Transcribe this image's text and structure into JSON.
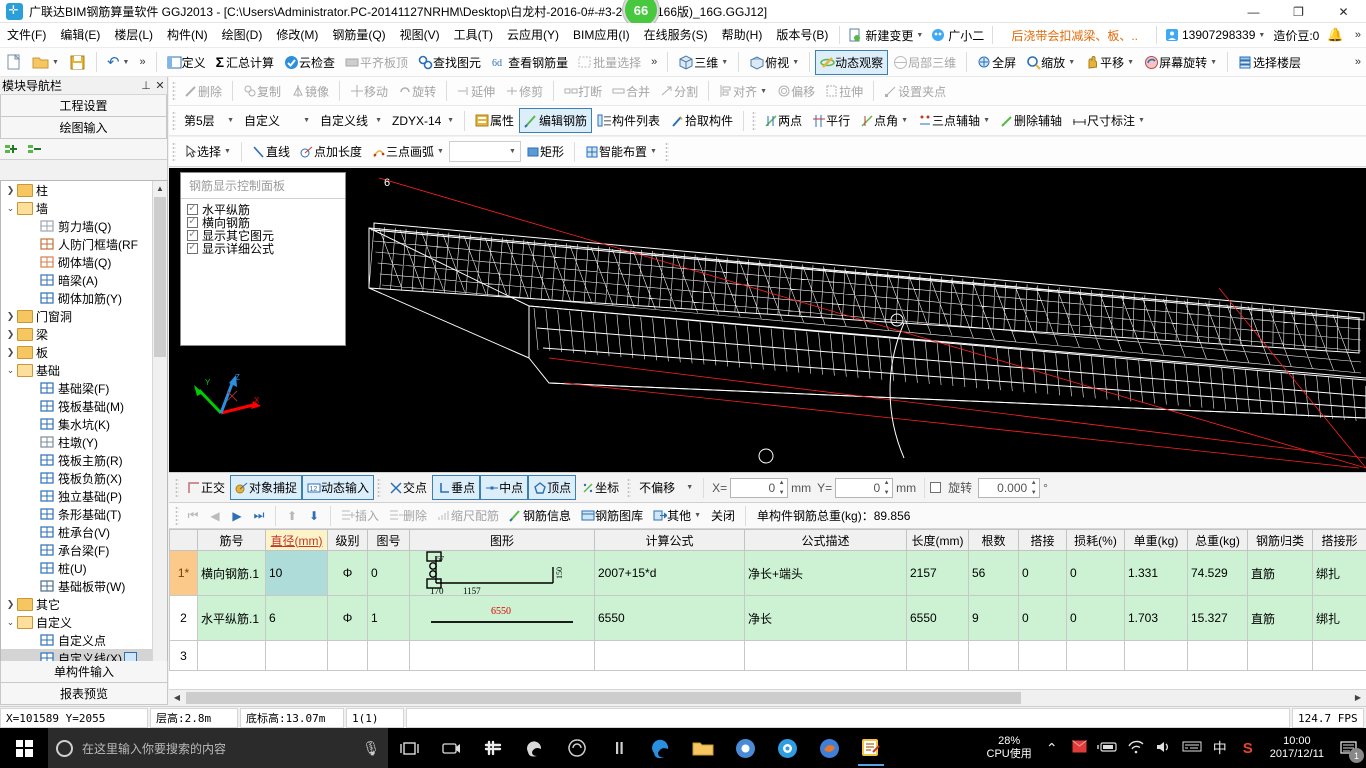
{
  "window": {
    "title": "广联达BIM钢筋算量软件 GGJ2013 - [C:\\Users\\Administrator.PC-20141127NRHM\\Desktop\\白龙村-2016-0#-#3-27-07(2166版)_16G.GGJ12]",
    "badge": "66",
    "minimize": "—",
    "maximize": "❐",
    "close": "✕",
    "app_icon": "bim-app-icon"
  },
  "menubar": {
    "items": [
      "文件(F)",
      "编辑(E)",
      "楼层(L)",
      "构件(N)",
      "绘图(D)",
      "修改(M)",
      "钢筋量(Q)",
      "视图(V)",
      "工具(T)",
      "云应用(Y)",
      "BIM应用(I)",
      "在线服务(S)",
      "帮助(H)",
      "版本号(B)"
    ],
    "new_change": "新建变更",
    "user_nick": "广小二",
    "promo": "后浇带会扣减梁、板、..",
    "phone": "13907298339",
    "coin_label": "造价豆:0",
    "overflow": "»"
  },
  "toolbar1": {
    "left_icons": [
      "new-file-icon",
      "open-folder-icon",
      "save-icon",
      "undo-icon"
    ],
    "overflow": "»",
    "buttons": [
      {
        "label": "定义",
        "icon": "define-icon",
        "enabled": true
      },
      {
        "label": "汇总计算",
        "icon": "sigma-icon",
        "enabled": true
      },
      {
        "label": "云检查",
        "icon": "cloud-check-icon",
        "enabled": true
      },
      {
        "label": "平齐板顶",
        "icon": "align-slab-icon",
        "enabled": false
      },
      {
        "label": "查找图元",
        "icon": "find-element-icon",
        "enabled": true
      },
      {
        "label": "查看钢筋量",
        "icon": "view-rebar-icon",
        "enabled": true
      },
      {
        "label": "批量选择",
        "icon": "batch-select-icon",
        "enabled": false
      }
    ],
    "view_buttons": [
      {
        "label": "三维",
        "icon": "cube-3d-icon",
        "enabled": true,
        "dropdown": true
      },
      {
        "label": "俯视",
        "icon": "topview-icon",
        "enabled": true,
        "dropdown": true
      },
      {
        "label": "动态观察",
        "icon": "orbit-icon",
        "enabled": true,
        "selected": true
      },
      {
        "label": "局部三维",
        "icon": "partial-3d-icon",
        "enabled": false
      },
      {
        "label": "全屏",
        "icon": "fullscreen-icon",
        "enabled": true
      },
      {
        "label": "缩放",
        "icon": "zoom-icon",
        "enabled": true,
        "dropdown": true
      },
      {
        "label": "平移",
        "icon": "pan-hand-icon",
        "enabled": true,
        "dropdown": true
      },
      {
        "label": "屏幕旋转",
        "icon": "screen-rotate-icon",
        "enabled": true,
        "dropdown": true
      },
      {
        "label": "选择楼层",
        "icon": "select-floor-icon",
        "enabled": true
      }
    ]
  },
  "toolbar2": {
    "buttons": [
      {
        "label": "删除",
        "icon": "delete-icon"
      },
      {
        "label": "复制",
        "icon": "copy-icon"
      },
      {
        "label": "镜像",
        "icon": "mirror-icon"
      },
      {
        "label": "移动",
        "icon": "move-icon"
      },
      {
        "label": "旋转",
        "icon": "rotate-icon"
      },
      {
        "label": "延伸",
        "icon": "extend-icon"
      },
      {
        "label": "修剪",
        "icon": "trim-icon"
      },
      {
        "label": "打断",
        "icon": "break-icon"
      },
      {
        "label": "合并",
        "icon": "merge-icon"
      },
      {
        "label": "分割",
        "icon": "split-icon"
      },
      {
        "label": "对齐",
        "icon": "align-icon",
        "dropdown": true
      },
      {
        "label": "偏移",
        "icon": "offset-icon"
      },
      {
        "label": "拉伸",
        "icon": "stretch-icon"
      },
      {
        "label": "设置夹点",
        "icon": "set-grip-icon"
      }
    ]
  },
  "toolbar3": {
    "floor": "第5层",
    "type1": "自定义",
    "type2": "自定义线",
    "component": "ZDYX-14",
    "buttons": [
      {
        "label": "属性",
        "icon": "properties-icon",
        "selected": false
      },
      {
        "label": "编辑钢筋",
        "icon": "edit-rebar-icon",
        "selected": true
      },
      {
        "label": "构件列表",
        "icon": "component-list-icon",
        "selected": false
      },
      {
        "label": "拾取构件",
        "icon": "pick-component-icon",
        "selected": false
      }
    ],
    "axis_buttons": [
      {
        "label": "两点",
        "icon": "two-point-icon"
      },
      {
        "label": "平行",
        "icon": "parallel-icon"
      },
      {
        "label": "点角",
        "icon": "point-angle-icon",
        "dropdown": true
      },
      {
        "label": "三点辅轴",
        "icon": "three-point-axis-icon",
        "dropdown": true
      },
      {
        "label": "删除辅轴",
        "icon": "delete-axis-icon"
      },
      {
        "label": "尺寸标注",
        "icon": "dimension-icon",
        "dropdown": true
      }
    ]
  },
  "toolbar4": {
    "buttons": [
      {
        "label": "选择",
        "icon": "cursor-select-icon",
        "dropdown": true
      },
      {
        "label": "直线",
        "icon": "line-icon"
      },
      {
        "label": "点加长度",
        "icon": "point-length-icon"
      },
      {
        "label": "三点画弧",
        "icon": "three-point-arc-icon",
        "dropdown": true
      }
    ],
    "combo_value": "",
    "buttons2": [
      {
        "label": "矩形",
        "icon": "rectangle-icon"
      },
      {
        "label": "智能布置",
        "icon": "smart-layout-icon",
        "dropdown": true
      }
    ]
  },
  "sidebar": {
    "title": "模块导航栏",
    "pin": "⊥",
    "close": "✕",
    "nav_buttons_top": [
      "工程设置",
      "绘图输入"
    ],
    "nav_buttons_bottom": [
      "单构件输入",
      "报表预览"
    ],
    "tree": [
      {
        "label": "柱",
        "depth": 1,
        "twisty": "collapsed",
        "icon": "folder-icon"
      },
      {
        "label": "墙",
        "depth": 1,
        "twisty": "expanded",
        "icon": "folder-open-icon"
      },
      {
        "label": "剪力墙(Q)",
        "depth": 2,
        "icon": "shear-wall-icon"
      },
      {
        "label": "人防门框墙(RF",
        "depth": 2,
        "icon": "door-frame-wall-icon"
      },
      {
        "label": "砌体墙(Q)",
        "depth": 2,
        "icon": "masonry-wall-icon"
      },
      {
        "label": "暗梁(A)",
        "depth": 2,
        "icon": "hidden-beam-icon"
      },
      {
        "label": "砌体加筋(Y)",
        "depth": 2,
        "icon": "masonry-rebar-icon"
      },
      {
        "label": "门窗洞",
        "depth": 1,
        "twisty": "collapsed",
        "icon": "folder-icon"
      },
      {
        "label": "梁",
        "depth": 1,
        "twisty": "collapsed",
        "icon": "folder-icon"
      },
      {
        "label": "板",
        "depth": 1,
        "twisty": "collapsed",
        "icon": "folder-icon"
      },
      {
        "label": "基础",
        "depth": 1,
        "twisty": "expanded",
        "icon": "folder-open-icon"
      },
      {
        "label": "基础梁(F)",
        "depth": 2,
        "icon": "foundation-beam-icon"
      },
      {
        "label": "筏板基础(M)",
        "depth": 2,
        "icon": "raft-foundation-icon"
      },
      {
        "label": "集水坑(K)",
        "depth": 2,
        "icon": "sump-pit-icon"
      },
      {
        "label": "柱墩(Y)",
        "depth": 2,
        "icon": "column-pier-icon"
      },
      {
        "label": "筏板主筋(R)",
        "depth": 2,
        "icon": "raft-main-rebar-icon"
      },
      {
        "label": "筏板负筋(X)",
        "depth": 2,
        "icon": "raft-neg-rebar-icon"
      },
      {
        "label": "独立基础(P)",
        "depth": 2,
        "icon": "isolated-foundation-icon"
      },
      {
        "label": "条形基础(T)",
        "depth": 2,
        "icon": "strip-foundation-icon"
      },
      {
        "label": "桩承台(V)",
        "depth": 2,
        "icon": "pile-cap-icon"
      },
      {
        "label": "承台梁(F)",
        "depth": 2,
        "icon": "cap-beam-icon"
      },
      {
        "label": "桩(U)",
        "depth": 2,
        "icon": "pile-icon"
      },
      {
        "label": "基础板带(W)",
        "depth": 2,
        "icon": "foundation-band-icon"
      },
      {
        "label": "其它",
        "depth": 1,
        "twisty": "collapsed",
        "icon": "folder-icon"
      },
      {
        "label": "自定义",
        "depth": 1,
        "twisty": "expanded",
        "icon": "folder-open-icon"
      },
      {
        "label": "自定义点",
        "depth": 2,
        "icon": "custom-point-icon"
      },
      {
        "label": "自定义线(X)",
        "depth": 2,
        "icon": "custom-line-icon",
        "selected": true
      },
      {
        "label": "自定义面",
        "depth": 2,
        "icon": "custom-face-icon"
      },
      {
        "label": "尺寸标注(W)",
        "depth": 2,
        "icon": "dimension-icon"
      }
    ]
  },
  "viewport": {
    "panel": {
      "title": "钢筋显示控制面板",
      "checkboxes": [
        {
          "label": "水平纵筋",
          "checked": true
        },
        {
          "label": "横向钢筋",
          "checked": true
        },
        {
          "label": "显示其它图元",
          "checked": true
        },
        {
          "label": "显示详细公式",
          "checked": true
        }
      ]
    },
    "axis_labels": [
      "X",
      "Y",
      "Z"
    ],
    "axis_colors": {
      "x": "#ff0000",
      "y": "#00cc00",
      "z": "#2b8fe0"
    }
  },
  "drawbar": {
    "toggles": [
      {
        "label": "正交",
        "icon": "ortho-icon",
        "active": false
      },
      {
        "label": "对象捕捉",
        "icon": "object-snap-icon",
        "active": true
      },
      {
        "label": "动态输入",
        "icon": "dynamic-input-icon",
        "active": true
      }
    ],
    "snaps": [
      {
        "label": "交点",
        "icon": "intersection-icon",
        "active": false
      },
      {
        "label": "垂点",
        "icon": "perpendicular-icon",
        "active": true
      },
      {
        "label": "中点",
        "icon": "midpoint-icon",
        "active": true
      },
      {
        "label": "顶点",
        "icon": "vertex-icon",
        "active": true
      },
      {
        "label": "坐标",
        "icon": "coordinate-icon",
        "active": false
      }
    ],
    "offset_mode": "不偏移",
    "x_label": "X=",
    "x_value": "0",
    "x_unit": "mm",
    "y_label": "Y=",
    "y_value": "0",
    "y_unit": "mm",
    "rotate_label": "旋转",
    "rotate_value": "0.000",
    "rotate_unit": "°"
  },
  "rebarbar": {
    "nav": [
      "⏮",
      "◀",
      "▶",
      "⏭",
      "⬆",
      "⬇"
    ],
    "buttons": [
      {
        "label": "插入",
        "icon": "insert-row-icon",
        "enabled": false
      },
      {
        "label": "删除",
        "icon": "delete-row-icon",
        "enabled": false
      },
      {
        "label": "缩尺配筋",
        "icon": "scale-rebar-icon",
        "enabled": false
      },
      {
        "label": "钢筋信息",
        "icon": "rebar-info-icon",
        "enabled": true
      },
      {
        "label": "钢筋图库",
        "icon": "rebar-library-icon",
        "enabled": true
      },
      {
        "label": "其他",
        "icon": "other-icon",
        "enabled": true,
        "dropdown": true
      },
      {
        "label": "关闭",
        "icon": "close-panel-icon",
        "enabled": true
      }
    ],
    "total_label": "单构件钢筋总重(kg)：",
    "total_value": "89.856"
  },
  "table": {
    "headers": [
      "",
      "筋号",
      "直径(mm)",
      "级别",
      "图号",
      "图形",
      "计算公式",
      "公式描述",
      "长度(mm)",
      "根数",
      "搭接",
      "损耗(%)",
      "单重(kg)",
      "总重(kg)",
      "钢筋归类",
      "搭接形"
    ],
    "rows": [
      {
        "no": "1*",
        "name": "横向钢筋.1",
        "diameter": "10",
        "grade": "Φ",
        "figure_no": "0",
        "shape": {
          "type": "hook-z",
          "dims": [
            "170",
            "1157",
            "150",
            "57"
          ]
        },
        "formula": "2007+15*d",
        "formula_desc": "净长+端头",
        "length": "2157",
        "count": "56",
        "lap": "0",
        "loss": "0",
        "unit_weight": "1.331",
        "total_weight": "74.529",
        "category": "直筋",
        "lap_form": "绑扎"
      },
      {
        "no": "2",
        "name": "水平纵筋.1",
        "diameter": "6",
        "grade": "Φ",
        "figure_no": "1",
        "shape": {
          "type": "straight",
          "dims": [
            "6550"
          ]
        },
        "formula": "6550",
        "formula_desc": "净长",
        "length": "6550",
        "count": "9",
        "lap": "0",
        "loss": "0",
        "unit_weight": "1.703",
        "total_weight": "15.327",
        "category": "直筋",
        "lap_form": "绑扎"
      },
      {
        "no": "3",
        "name": "",
        "diameter": "",
        "grade": "",
        "figure_no": "",
        "shape": null,
        "formula": "",
        "formula_desc": "",
        "length": "",
        "count": "",
        "lap": "",
        "loss": "",
        "unit_weight": "",
        "total_weight": "",
        "category": "",
        "lap_form": ""
      }
    ]
  },
  "statusbar": {
    "coords": "X=101589  Y=2055",
    "floor_height": "层高:2.8m",
    "base_elev": "底标高:13.07m",
    "page": "1(1)",
    "fps": "124.7 FPS"
  },
  "taskbar": {
    "search_placeholder": "在这里输入你要搜索的内容",
    "icons": [
      "task-view-icon",
      "camera-icon",
      "slack-icon",
      "edge-legacy-icon",
      "cortana-icon",
      "pause-icon",
      "edge-icon",
      "explorer-icon",
      "chrome-icon",
      "sogou-browser-icon",
      "firefox-icon",
      "ggj-app-icon"
    ],
    "cpu_percent": "28%",
    "cpu_label": "CPU使用",
    "tray_icons": [
      "chevron-up-icon",
      "red-envelope-icon",
      "battery-icon",
      "wifi-icon",
      "volume-icon",
      "keyboard-icon",
      "ime-cn-icon",
      "sogou-icon"
    ],
    "time": "10:00",
    "date": "2017/12/11",
    "notif_count": "1"
  }
}
